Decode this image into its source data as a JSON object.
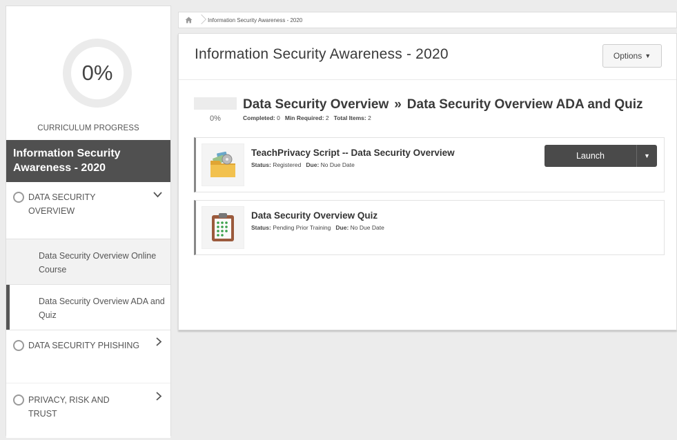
{
  "sidebar": {
    "progress_value": "0%",
    "progress_label": "CURRICULUM PROGRESS",
    "title": "Information Security Awareness - 2020",
    "sections": [
      {
        "label": "DATA SECURITY OVERVIEW",
        "expanded": true
      },
      {
        "label": "DATA SECURITY PHISHING",
        "expanded": false
      },
      {
        "label": "PRIVACY, RISK AND TRUST",
        "expanded": false
      }
    ],
    "sub_items": [
      {
        "label": "Data Security Overview Online Course"
      },
      {
        "label": "Data Security Overview ADA and Quiz",
        "active": true
      }
    ]
  },
  "breadcrumb": {
    "home_icon": "home-icon",
    "current": "Information Security Awareness - 2020"
  },
  "main": {
    "title": "Information Security Awareness - 2020",
    "options_label": "Options",
    "section": {
      "progress_pct": "0%",
      "parent": "Data Security Overview",
      "separator": "»",
      "current": "Data Security Overview ADA and Quiz",
      "completed_label": "Completed:",
      "completed_value": "0",
      "min_required_label": "Min Required:",
      "min_required_value": "2",
      "total_items_label": "Total Items:",
      "total_items_value": "2"
    },
    "items": [
      {
        "title": "TeachPrivacy Script -- Data Security Overview",
        "status_label": "Status:",
        "status_value": "Registered",
        "due_label": "Due:",
        "due_value": "No Due Date",
        "action_label": "Launch",
        "icon": "folder-icon"
      },
      {
        "title": "Data Security Overview Quiz",
        "status_label": "Status:",
        "status_value": "Pending Prior Training",
        "due_label": "Due:",
        "due_value": "No Due Date",
        "icon": "clipboard-quiz-icon"
      }
    ]
  },
  "colors": {
    "sidebar_title_bg": "#505050",
    "launch_bg": "#4a4a4a",
    "page_bg": "#ececec"
  }
}
